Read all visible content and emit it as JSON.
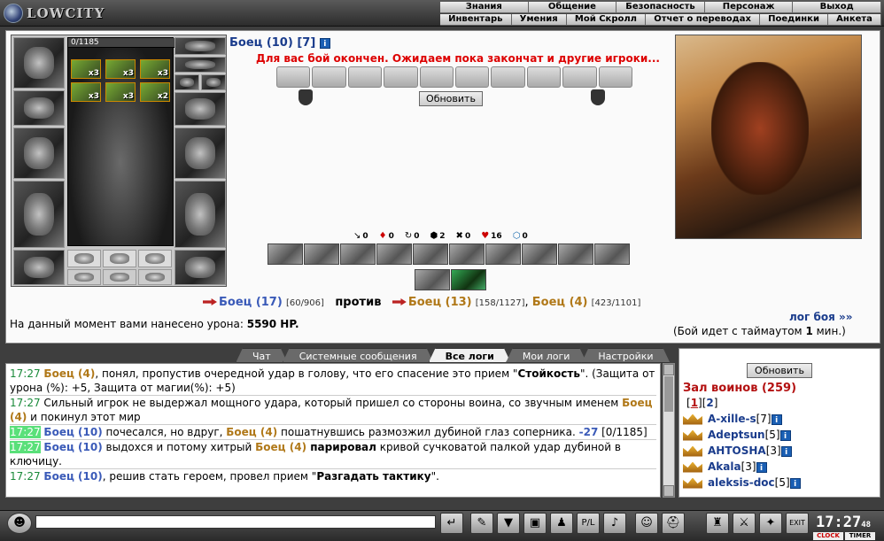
{
  "app": {
    "logo_text": "LOWCITY"
  },
  "menu_primary": [
    "Знания",
    "Общение",
    "Безопасность",
    "Персонаж",
    "Выход"
  ],
  "menu_secondary": [
    "Инвентарь",
    "Умения",
    "Мой Скролл",
    "Отчет о переводах",
    "Поединки",
    "Анкета"
  ],
  "character": {
    "hp_text": "0/1185",
    "effects": [
      {
        "count": "x3"
      },
      {
        "count": "x3"
      },
      {
        "count": "x3"
      },
      {
        "count": "x3"
      },
      {
        "count": "x3"
      },
      {
        "count": "x2"
      }
    ]
  },
  "battle": {
    "fighter_title": "Боец (10)",
    "fighter_extra": "[7]",
    "info_glyph": "i",
    "finish_message": "Для вас бой окончен. Ожидаем пока закончат и другие игроки...",
    "refresh_label": "Обновить",
    "stats": [
      {
        "icon": "↘",
        "value": "0"
      },
      {
        "icon": "♦",
        "value": "0"
      },
      {
        "icon": "↻",
        "value": "0"
      },
      {
        "icon": "⬢",
        "value": "2"
      },
      {
        "icon": "✖",
        "value": "0"
      },
      {
        "icon": "♥",
        "value": "16"
      },
      {
        "icon": "⬡",
        "value": "0"
      }
    ],
    "side_a": {
      "name": "Боец (17)",
      "hp": "[60/906]"
    },
    "vs_label": "против",
    "side_b": [
      {
        "name": "Боец (13)",
        "hp": "[158/1127]"
      },
      {
        "name": "Боец (4)",
        "hp": "[423/1101]"
      }
    ],
    "damage_prefix": "На данный момент вами нанесено урона:",
    "damage_value": "5590 HP.",
    "log_link": "лог боя »»",
    "timeout_prefix": "(Бой идет с таймаутом",
    "timeout_value": "1",
    "timeout_suffix": "мин.)"
  },
  "tabs": [
    "Чат",
    "Системные сообщения",
    "Все логи",
    "Мои логи",
    "Настройки"
  ],
  "chat": [
    {
      "time": "17:27",
      "parts": [
        {
          "c": "b2",
          "t": "Боец (4)"
        },
        {
          "c": "",
          "t": ", понял, пропустив очередной удар в голову, что его спасение это прием \""
        },
        {
          "c": "bold",
          "t": "Стойкость"
        },
        {
          "c": "",
          "t": "\". (Защита от урона (%): +5, Защита от магии(%): +5)"
        }
      ]
    },
    {
      "time": "17:27",
      "parts": [
        {
          "c": "",
          "t": "Сильный игрок не выдержал мощного удара, который пришел со стороны воина, со звучным именем "
        },
        {
          "c": "b2",
          "t": "Боец (4)"
        },
        {
          "c": "",
          "t": " и покинул этот мир"
        }
      ]
    },
    {
      "time": "17:27",
      "hl": true,
      "parts": [
        {
          "c": "b1",
          "t": "Боец (10)"
        },
        {
          "c": "",
          "t": " почесался, но вдруг, "
        },
        {
          "c": "b2",
          "t": "Боец (4)"
        },
        {
          "c": "",
          "t": " пошатнувшись размозжил дубиной глаз соперника. "
        },
        {
          "c": "b1",
          "t": "-27"
        },
        {
          "c": "",
          "t": " [0/1185]"
        }
      ]
    },
    {
      "time": "17:27",
      "hl": true,
      "parts": [
        {
          "c": "b1",
          "t": "Боец (10)"
        },
        {
          "c": "",
          "t": " выдохся и потому хитрый "
        },
        {
          "c": "b2",
          "t": "Боец (4)"
        },
        {
          "c": "bold",
          "t": " парировал"
        },
        {
          "c": "",
          "t": " кривой сучковатой палкой удар дубиной в ключицу."
        }
      ]
    },
    {
      "time": "17:27",
      "parts": [
        {
          "c": "b1",
          "t": "Боец (10)"
        },
        {
          "c": "",
          "t": ", решив стать героем, провел прием \""
        },
        {
          "c": "bold",
          "t": "Разгадать тактику"
        },
        {
          "c": "",
          "t": "\"."
        }
      ]
    }
  ],
  "warriors": {
    "refresh_label": "Обновить",
    "title": "Зал воинов (259)",
    "page_current": "1",
    "page_other": "2",
    "list": [
      {
        "name": "A-xille-s",
        "level": "[7]"
      },
      {
        "name": "Adeptsun",
        "level": "[5]"
      },
      {
        "name": "AHTOSHA",
        "level": "[3]"
      },
      {
        "name": "Akala",
        "level": "[3]"
      },
      {
        "name": "aleksis-doc",
        "level": "[5]"
      }
    ]
  },
  "toolbar": {
    "clock": "17:27",
    "clock_sec": "48",
    "clock_label": "CLOCK",
    "timer_label": "TIMER"
  }
}
